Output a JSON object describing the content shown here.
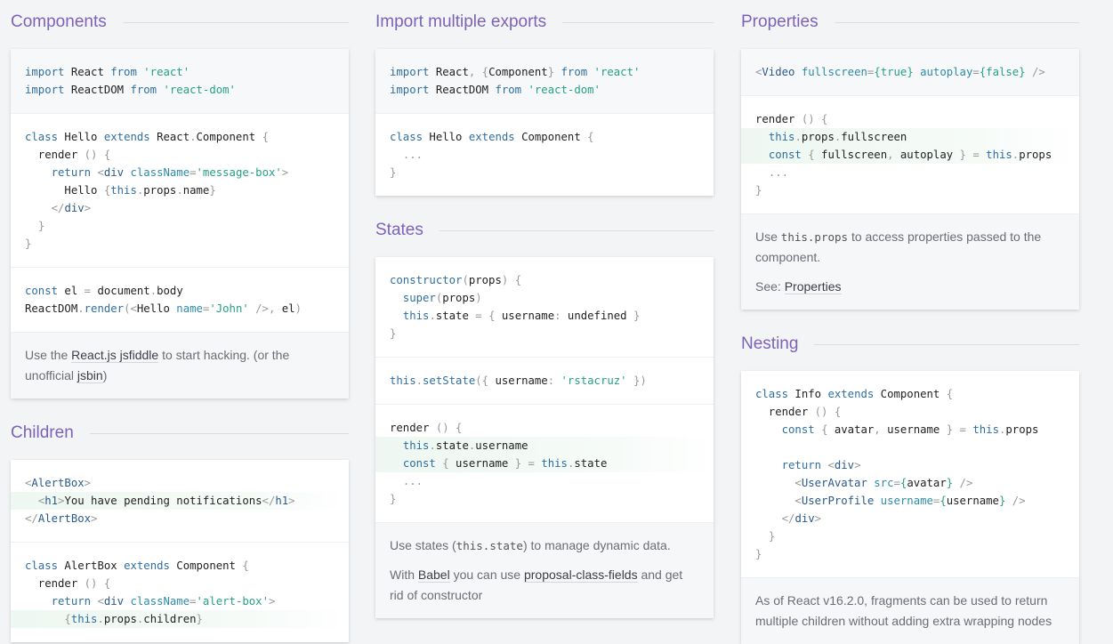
{
  "sections": {
    "components": {
      "title": "Components",
      "note": {
        "before": "Use the ",
        "link1": "React.js jsfiddle",
        "mid": " to start hacking. (or the unofficial ",
        "link2": "jsbin",
        "after": ")"
      }
    },
    "children": {
      "title": "Children"
    },
    "import_exports": {
      "title": "Import multiple exports"
    },
    "states": {
      "title": "States",
      "note1": {
        "before": "Use states (",
        "code": "this.state",
        "after": ") to manage dynamic data."
      },
      "note2": {
        "before": "With ",
        "link1": "Babel",
        "mid": " you can use ",
        "link2": "proposal-class-fields",
        "after": " and get rid of constructor"
      }
    },
    "properties": {
      "title": "Properties",
      "note1": {
        "before": "Use ",
        "code": "this.props",
        "after": " to access properties passed to the component."
      },
      "note2": {
        "before": "See: ",
        "link": "Properties"
      }
    },
    "nesting": {
      "title": "Nesting",
      "note": "As of React v16.2.0, fragments can be used to return multiple children without adding extra wrapping nodes"
    }
  }
}
